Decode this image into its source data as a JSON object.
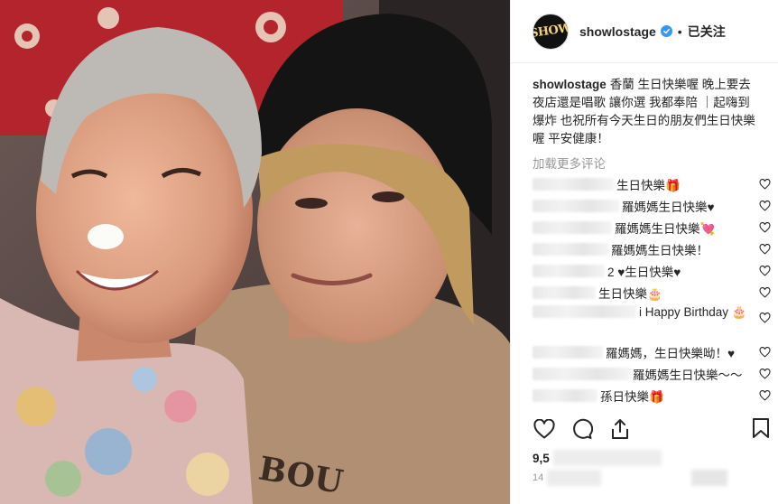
{
  "post": {
    "username": "showlostage",
    "avatar_text": "SHOW",
    "follow_status": "已关注",
    "separator": "•",
    "caption_user": "showlostage",
    "caption_text": "香蘭 生日快樂喔 晚上要去夜店還是唱歌 讓你選 我都奉陪 ｜起嗨到爆炸 也祝所有今天生日的朋友們生日快樂喔 平安健康！",
    "load_more": "加载更多评论",
    "likes_prefix": "9,5",
    "timestamp_prefix": "14",
    "photo_text": "BOU"
  },
  "comments": [
    {
      "text": "生日快樂🎁"
    },
    {
      "text": "羅媽媽生日快樂♥"
    },
    {
      "text": "羅媽媽生日快樂💘"
    },
    {
      "text": "羅媽媽生日快樂！"
    },
    {
      "text": "2 ♥生日快樂♥"
    },
    {
      "text": "生日快樂🎂"
    },
    {
      "text": "i Happy Birthday 🎂"
    },
    {
      "text": "羅媽媽，生日快樂呦！♥"
    },
    {
      "text": "羅媽媽生日快樂～～"
    },
    {
      "text": "孫日快樂🎁"
    }
  ],
  "icons": {
    "verified": "verified-badge-icon",
    "like": "heart-icon",
    "comment": "comment-bubble-icon",
    "share": "share-icon",
    "save": "bookmark-icon"
  },
  "colors": {
    "verified_blue": "#3897f0",
    "muted_text": "#999999",
    "border": "#efefef"
  }
}
